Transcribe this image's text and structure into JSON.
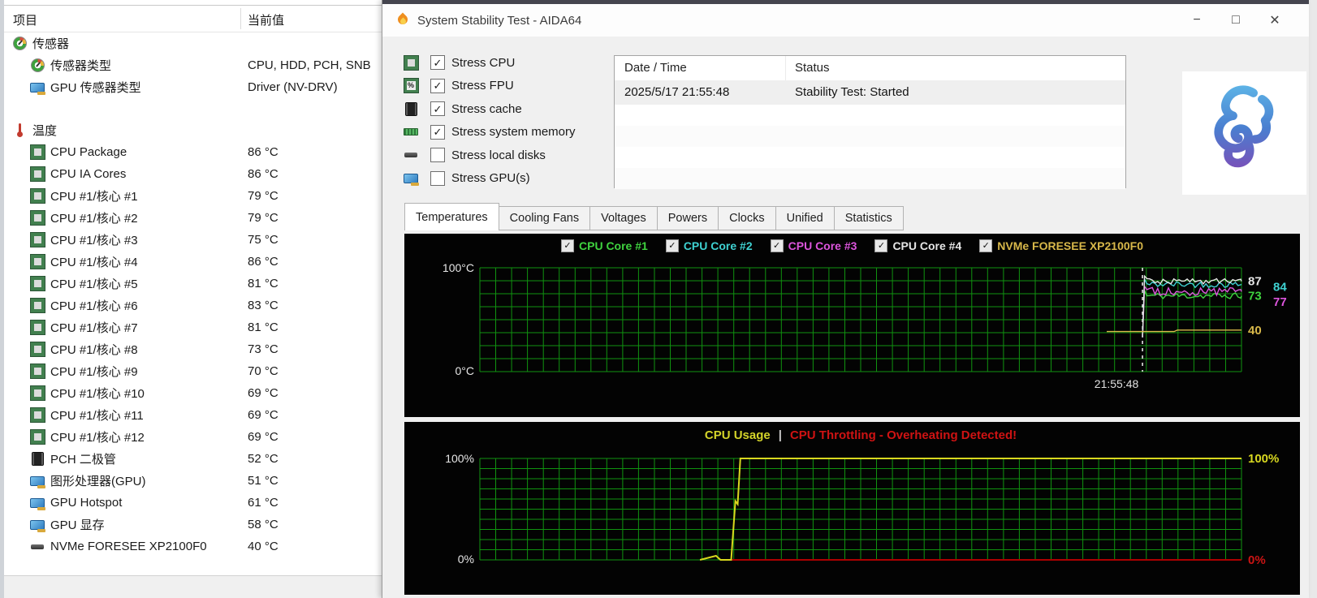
{
  "sensor_panel": {
    "header": {
      "item": "项目",
      "value": "当前值"
    },
    "rows": [
      {
        "icon": "gauge-icon",
        "label": "传感器",
        "value": "",
        "indent": 0,
        "gap_before": 0
      },
      {
        "icon": "gauge-icon",
        "label": "传感器类型",
        "value": "CPU, HDD, PCH, SNB",
        "indent": 1,
        "gap_before": 0
      },
      {
        "icon": "gpu-icon",
        "label": "GPU 传感器类型",
        "value": "Driver (NV-DRV)",
        "indent": 1,
        "gap_before": 0
      },
      {
        "icon": "thermo-icon",
        "label": "温度",
        "value": "",
        "indent": 0,
        "gap_before": 26
      },
      {
        "icon": "cpu-icon",
        "label": "CPU Package",
        "value": "86 °C",
        "indent": 1,
        "gap_before": 0
      },
      {
        "icon": "cpu-icon",
        "label": "CPU IA Cores",
        "value": "86 °C",
        "indent": 1,
        "gap_before": 0
      },
      {
        "icon": "cpu-icon",
        "label": "CPU #1/核心 #1",
        "value": "79 °C",
        "indent": 1,
        "gap_before": 0
      },
      {
        "icon": "cpu-icon",
        "label": "CPU #1/核心 #2",
        "value": "79 °C",
        "indent": 1,
        "gap_before": 0
      },
      {
        "icon": "cpu-icon",
        "label": "CPU #1/核心 #3",
        "value": "75 °C",
        "indent": 1,
        "gap_before": 0
      },
      {
        "icon": "cpu-icon",
        "label": "CPU #1/核心 #4",
        "value": "86 °C",
        "indent": 1,
        "gap_before": 0
      },
      {
        "icon": "cpu-icon",
        "label": "CPU #1/核心 #5",
        "value": "81 °C",
        "indent": 1,
        "gap_before": 0
      },
      {
        "icon": "cpu-icon",
        "label": "CPU #1/核心 #6",
        "value": "83 °C",
        "indent": 1,
        "gap_before": 0
      },
      {
        "icon": "cpu-icon",
        "label": "CPU #1/核心 #7",
        "value": "81 °C",
        "indent": 1,
        "gap_before": 0
      },
      {
        "icon": "cpu-icon",
        "label": "CPU #1/核心 #8",
        "value": "73 °C",
        "indent": 1,
        "gap_before": 0
      },
      {
        "icon": "cpu-icon",
        "label": "CPU #1/核心 #9",
        "value": "70 °C",
        "indent": 1,
        "gap_before": 0
      },
      {
        "icon": "cpu-icon",
        "label": "CPU #1/核心 #10",
        "value": "69 °C",
        "indent": 1,
        "gap_before": 0
      },
      {
        "icon": "cpu-icon",
        "label": "CPU #1/核心 #11",
        "value": "69 °C",
        "indent": 1,
        "gap_before": 0
      },
      {
        "icon": "cpu-icon",
        "label": "CPU #1/核心 #12",
        "value": "69 °C",
        "indent": 1,
        "gap_before": 0
      },
      {
        "icon": "chip-icon",
        "label": "PCH 二极管",
        "value": "52 °C",
        "indent": 1,
        "gap_before": 0
      },
      {
        "icon": "gpu-icon",
        "label": "图形处理器(GPU)",
        "value": "51 °C",
        "indent": 1,
        "gap_before": 0
      },
      {
        "icon": "gpu-icon",
        "label": "GPU Hotspot",
        "value": "61 °C",
        "indent": 1,
        "gap_before": 0
      },
      {
        "icon": "gpu-icon",
        "label": "GPU 显存",
        "value": "58 °C",
        "indent": 1,
        "gap_before": 0
      },
      {
        "icon": "disk-icon",
        "label": "NVMe FORESEE XP2100F0",
        "value": "40 °C",
        "indent": 1,
        "gap_before": 0
      }
    ]
  },
  "window": {
    "title": "System Stability Test - AIDA64",
    "controls": {
      "minimize": "−",
      "maximize": "□",
      "close": "✕"
    }
  },
  "stress_options": [
    {
      "icon": "cpu-icon",
      "label": "Stress CPU",
      "checked": true
    },
    {
      "icon": "fpu-icon",
      "label": "Stress FPU",
      "checked": true
    },
    {
      "icon": "cache-icon",
      "label": "Stress cache",
      "checked": true
    },
    {
      "icon": "memory-icon",
      "label": "Stress system memory",
      "checked": true
    },
    {
      "icon": "disk-icon",
      "label": "Stress local disks",
      "checked": false
    },
    {
      "icon": "gpu-icon",
      "label": "Stress GPU(s)",
      "checked": false
    }
  ],
  "status_table": {
    "columns": [
      "Date / Time",
      "Status"
    ],
    "rows": [
      {
        "datetime": "2025/5/17 21:55:48",
        "status": "Stability Test: Started"
      }
    ],
    "empty_row_count": 4
  },
  "tabs": [
    {
      "label": "Temperatures",
      "active": true
    },
    {
      "label": "Cooling Fans",
      "active": false
    },
    {
      "label": "Voltages",
      "active": false
    },
    {
      "label": "Powers",
      "active": false
    },
    {
      "label": "Clocks",
      "active": false
    },
    {
      "label": "Unified",
      "active": false
    },
    {
      "label": "Statistics",
      "active": false
    }
  ],
  "chart_data": [
    {
      "type": "line",
      "name": "temperatures",
      "bg": "#030303",
      "grid_color": "#109310",
      "y_axis": {
        "top_label": "100°C",
        "bottom_label": "0°C",
        "min": 0,
        "max": 100
      },
      "x_axis": {
        "time_label": "21:55:48",
        "test_start_frac": 0.87
      },
      "legend": [
        {
          "label": "CPU Core #1",
          "color": "#3fd23f",
          "checked": true
        },
        {
          "label": "CPU Core #2",
          "color": "#3fd2d2",
          "checked": true
        },
        {
          "label": "CPU Core #3",
          "color": "#dd55dd",
          "checked": true
        },
        {
          "label": "CPU Core #4",
          "color": "#e6e6e6",
          "checked": true
        },
        {
          "label": "NVMe FORESEE XP2100F0",
          "color": "#d8b84a",
          "checked": true
        }
      ],
      "series": [
        {
          "name": "CPU Core #1",
          "color": "#3fd23f",
          "current": 73,
          "jitter": 3.0,
          "start_frac": 0.87,
          "flat": false
        },
        {
          "name": "CPU Core #2",
          "color": "#3fd2d2",
          "current": 84,
          "jitter": 3.0,
          "start_frac": 0.87,
          "flat": false
        },
        {
          "name": "CPU Core #3",
          "color": "#dd55dd",
          "current": 77,
          "jitter": 4.0,
          "start_frac": 0.87,
          "flat": false
        },
        {
          "name": "CPU Core #4",
          "color": "#e6e6e6",
          "current": 87,
          "jitter": 2.5,
          "start_frac": 0.87,
          "flat": false
        },
        {
          "name": "NVMe FORESEE XP2100F0",
          "color": "#d8b84a",
          "current": 40,
          "jitter": 0,
          "start_frac": 0.823,
          "flat": true
        }
      ],
      "value_labels": [
        {
          "text": "87",
          "color": "#e6e6e6",
          "col": 0,
          "pos": 87
        },
        {
          "text": "84",
          "color": "#3fd2d2",
          "col": 1,
          "pos": 81.5
        },
        {
          "text": "73",
          "color": "#3fd23f",
          "col": 0,
          "pos": 73
        },
        {
          "text": "77",
          "color": "#dd55dd",
          "col": 1,
          "pos": 67
        },
        {
          "text": "40",
          "color": "#d8b84a",
          "col": 0,
          "pos": 40
        }
      ]
    },
    {
      "type": "line",
      "name": "cpu-usage",
      "bg": "#030303",
      "grid_color": "#109310",
      "title_parts": [
        {
          "text": "CPU Usage",
          "color": "#d4d42a"
        },
        {
          "text": "|",
          "color": "#c8c8c8"
        },
        {
          "text": "CPU Throttling - Overheating Detected!",
          "color": "#cf1313"
        }
      ],
      "y_axis": {
        "top_label": "100%",
        "bottom_label": "0%",
        "min": 0,
        "max": 100
      },
      "right_labels": [
        {
          "text": "100%",
          "color": "#d8d820",
          "value": 100
        },
        {
          "text": "0%",
          "color": "#cc1414",
          "value": 0
        }
      ],
      "series": [
        {
          "name": "CPU Throttling",
          "color": "#ad0000",
          "points": [
            [
              0.328,
              0
            ],
            [
              1,
              0
            ]
          ]
        },
        {
          "name": "CPU Usage",
          "color": "#d8d81e",
          "points": [
            [
              0.289,
              0
            ],
            [
              0.31,
              4
            ],
            [
              0.316,
              0
            ],
            [
              0.33,
              0
            ],
            [
              0.3355,
              58
            ],
            [
              0.3385,
              55
            ],
            [
              0.342,
              100
            ],
            [
              1,
              100
            ]
          ]
        }
      ]
    }
  ]
}
